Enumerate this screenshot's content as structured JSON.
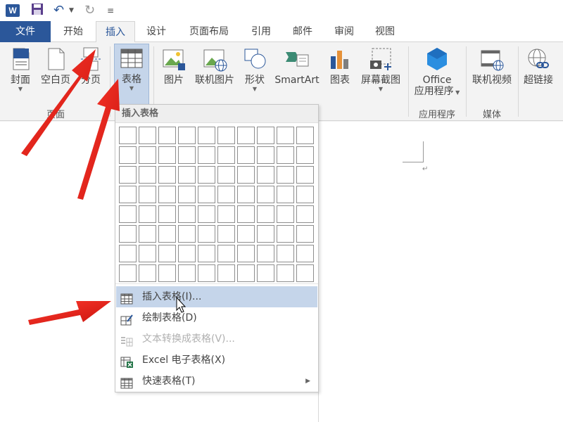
{
  "qat": {
    "undo": "↶",
    "redo": "↻",
    "customize": "≡"
  },
  "tabs": [
    "文件",
    "开始",
    "插入",
    "设计",
    "页面布局",
    "引用",
    "邮件",
    "审阅",
    "视图"
  ],
  "ribbon": {
    "buttons": {
      "cover": "封面",
      "blank_page": "空白页",
      "page_break": "分页",
      "table": "表格",
      "picture": "图片",
      "online_picture": "联机图片",
      "shapes": "形状",
      "smartart": "SmartArt",
      "chart": "图表",
      "screenshot": "屏幕截图",
      "office_app_1": "Office",
      "office_app_2": "应用程序",
      "online_video": "联机视频",
      "hyperlink": "超链接"
    },
    "groups": {
      "pages": "页面",
      "apps": "应用程序",
      "media": "媒体"
    }
  },
  "document": {
    "paragraph_mark": "↵"
  },
  "dropdown": {
    "header": "插入表格",
    "grid": {
      "cols": 10,
      "rows": 8
    },
    "items": [
      {
        "label": "插入表格(I)...",
        "state": "hover"
      },
      {
        "label": "绘制表格(D)",
        "state": "normal"
      },
      {
        "label": "文本转换成表格(V)...",
        "state": "disabled"
      },
      {
        "label": "Excel 电子表格(X)",
        "state": "normal"
      },
      {
        "label": "快速表格(T)",
        "state": "normal",
        "submenu": true
      }
    ]
  },
  "colors": {
    "accent": "#2b579a",
    "highlight": "#c5d5ea",
    "arrow": "#e8201a"
  }
}
